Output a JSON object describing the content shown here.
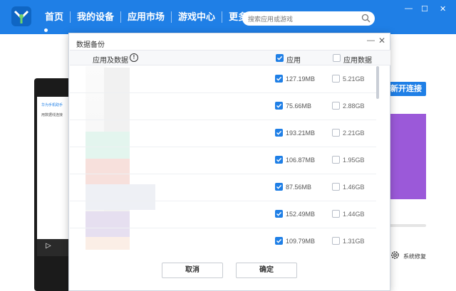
{
  "colors": {
    "accent": "#1f7fe6",
    "checkbox_on": "#1f7fe6",
    "purple_panel": "#9b59d9"
  },
  "topbar": {
    "nav": [
      "首页",
      "我的设备",
      "应用市场",
      "游戏中心",
      "更多服务"
    ],
    "search_placeholder": "搜索应用或游戏",
    "window_controls": [
      "—",
      "☐",
      "✕"
    ]
  },
  "background": {
    "phone_title": "华为手机助手",
    "phone_text": "用数据线连接",
    "connect_button": "新开连接",
    "system_repair": "系统修复"
  },
  "dialog": {
    "title": "数据备份",
    "col_app_data": "应用及数据",
    "col_app": "应用",
    "col_app_data_size": "应用数据",
    "rows": [
      {
        "app_size": "127.19MB",
        "data_size": "5.21GB",
        "app_checked": true,
        "data_checked": false
      },
      {
        "app_size": "75.66MB",
        "data_size": "2.88GB",
        "app_checked": true,
        "data_checked": false
      },
      {
        "app_size": "193.21MB",
        "data_size": "2.21GB",
        "app_checked": true,
        "data_checked": false
      },
      {
        "app_size": "106.87MB",
        "data_size": "1.95GB",
        "app_checked": true,
        "data_checked": false
      },
      {
        "app_size": "87.56MB",
        "data_size": "1.46GB",
        "app_checked": true,
        "data_checked": false
      },
      {
        "app_size": "152.49MB",
        "data_size": "1.44GB",
        "app_checked": true,
        "data_checked": false
      },
      {
        "app_size": "109.79MB",
        "data_size": "1.31GB",
        "app_checked": true,
        "data_checked": false
      }
    ],
    "cancel": "取消",
    "confirm": "确定"
  }
}
